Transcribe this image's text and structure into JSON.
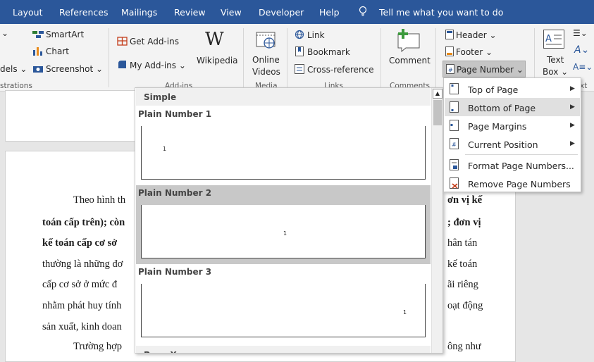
{
  "ribbon_tabs": [
    "Layout",
    "References",
    "Mailings",
    "Review",
    "View",
    "Developer",
    "Help"
  ],
  "tell_me": "Tell me what you want to do",
  "illustrations": {
    "smartart": "SmartArt",
    "chart": "Chart",
    "models": "dels",
    "screenshot": "Screenshot",
    "group": "strations"
  },
  "addins": {
    "get": "Get Add-ins",
    "my": "My Add-ins",
    "wikipedia": "Wikipedia",
    "wiki_letter": "W",
    "group": "Add-ins"
  },
  "media": {
    "online_videos_1": "Online",
    "online_videos_2": "Videos",
    "group": "Media"
  },
  "links": {
    "link": "Link",
    "bookmark": "Bookmark",
    "cross_ref": "Cross-reference",
    "group": "Links"
  },
  "comments": {
    "comment": "Comment",
    "group": "Comments"
  },
  "header_footer": {
    "header": "Header",
    "footer": "Footer",
    "page_number": "Page Number"
  },
  "text_group": {
    "text_box_1": "Text",
    "text_box_2": "Box",
    "group": "xt"
  },
  "document": {
    "lines": [
      {
        "l": "Theo hình th",
        "r": "ơn vị kế",
        "bold_r": true
      },
      {
        "l": "toán cấp trên); còn",
        "r": "; đơn vị",
        "bold_l": true,
        "bold_r": true
      },
      {
        "l": "kế toán cấp cơ sở",
        "r": "hân tán",
        "bold_l": true
      },
      {
        "l": "thường là những đơ",
        "r": "kế toán"
      },
      {
        "l": "cấp cơ sở ở mức đ",
        "r": "ãi riêng"
      },
      {
        "l": "nhằm phát huy tính",
        "r": "oạt động"
      },
      {
        "l": "sản xuất, kinh doan",
        "r": ""
      },
      {
        "l": "Trường hợp",
        "r": "ông như"
      }
    ]
  },
  "gallery": {
    "section": "Simple",
    "items": [
      {
        "label": "Plain Number 1",
        "mark": "1",
        "selected": false
      },
      {
        "label": "Plain Number 2",
        "mark": "1",
        "selected": true
      },
      {
        "label": "Plain Number 3",
        "mark": "1",
        "selected": false
      }
    ],
    "next_section": "Page X"
  },
  "page_number_menu": {
    "items": [
      {
        "label": "Top of Page",
        "submenu": true,
        "highlighted": false
      },
      {
        "label": "Bottom of Page",
        "submenu": true,
        "highlighted": true
      },
      {
        "label": "Page Margins",
        "submenu": true,
        "highlighted": false
      },
      {
        "label": "Current Position",
        "submenu": true,
        "highlighted": false
      },
      {
        "label": "Format Page Numbers...",
        "submenu": false,
        "highlighted": false
      },
      {
        "label": "Remove Page Numbers",
        "submenu": false,
        "highlighted": false
      }
    ]
  }
}
